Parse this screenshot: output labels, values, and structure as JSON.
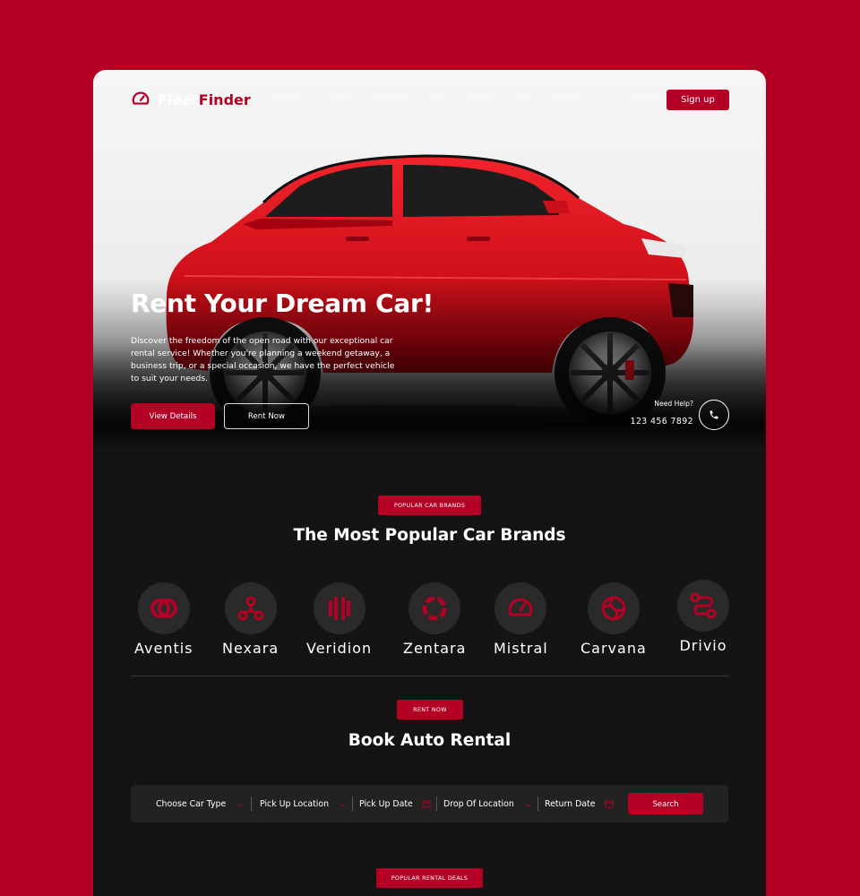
{
  "brand": {
    "part1": "Fleet",
    "part2": "Finder",
    "accent": "#B30024"
  },
  "nav": {
    "items": [
      "Home",
      "About",
      "Services",
      "Cars",
      "Pages",
      "Blog",
      "Contact"
    ],
    "signin": "Sign In",
    "signup": "Sign up"
  },
  "hero": {
    "title": "Rent Your Dream Car!",
    "description": "Discover the freedom of the open road with our exceptional car rental service! Whether you're planning a weekend getaway, a business trip, or a special occasion, we have the perfect vehicle to suit your needs.",
    "btn_details": "View Details",
    "btn_rent": "Rent Now",
    "help_label": "Need Help?",
    "help_phone": "123 456 7892"
  },
  "brands_section": {
    "tag": "POPULAR CAR BRANDS",
    "title": "The Most Popular Car Brands",
    "brands": [
      {
        "name": "Aventis",
        "icon": "overlap-circles-icon"
      },
      {
        "name": "Nexara",
        "icon": "nodes-icon"
      },
      {
        "name": "Veridion",
        "icon": "bars-circle-icon"
      },
      {
        "name": "Zentara",
        "icon": "segment-ring-icon"
      },
      {
        "name": "Mistral",
        "icon": "speedometer-icon"
      },
      {
        "name": "Carvana",
        "icon": "swirl-icon"
      },
      {
        "name": "Drivio",
        "icon": "route-icon"
      }
    ]
  },
  "rental_section": {
    "tag": "RENT NOW",
    "title": "Book Auto Rental",
    "fields": [
      "Choose Car Type",
      "Pick Up Location",
      "Pick Up Date",
      "Drop Of Location",
      "Return Date"
    ],
    "search": "Search"
  },
  "deals_section": {
    "tag": "POPULAR RENTAL DEALS"
  }
}
